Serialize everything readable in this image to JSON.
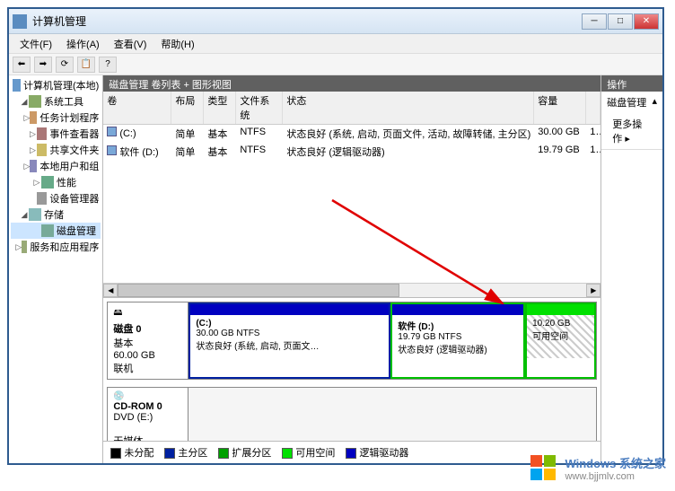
{
  "window": {
    "title": "计算机管理"
  },
  "menu": {
    "file": "文件(F)",
    "action": "操作(A)",
    "view": "查看(V)",
    "help": "帮助(H)"
  },
  "tree": {
    "root": "计算机管理(本地)",
    "system_tools": "系统工具",
    "task_scheduler": "任务计划程序",
    "event_viewer": "事件查看器",
    "shared_folders": "共享文件夹",
    "local_users": "本地用户和组",
    "performance": "性能",
    "device_manager": "设备管理器",
    "storage": "存储",
    "disk_management": "磁盘管理",
    "services": "服务和应用程序"
  },
  "center": {
    "header": "磁盘管理  卷列表 + 图形视图"
  },
  "vol_columns": {
    "volume": "卷",
    "layout": "布局",
    "type": "类型",
    "filesystem": "文件系统",
    "status": "状态",
    "capacity": "容量"
  },
  "volumes": [
    {
      "name": "(C:)",
      "layout": "简单",
      "type": "基本",
      "fs": "NTFS",
      "status": "状态良好 (系统, 启动, 页面文件, 活动, 故障转储, 主分区)",
      "capacity": "30.00 GB",
      "free": "1…"
    },
    {
      "name": "软件 (D:)",
      "layout": "简单",
      "type": "基本",
      "fs": "NTFS",
      "status": "状态良好 (逻辑驱动器)",
      "capacity": "19.79 GB",
      "free": "1…"
    }
  ],
  "disks": {
    "disk0": {
      "label": "磁盘 0",
      "type": "基本",
      "size": "60.00 GB",
      "state": "联机",
      "partitions": [
        {
          "title": "(C:)",
          "detail1": "30.00 GB NTFS",
          "detail2": "状态良好 (系统, 启动, 页面文…",
          "header_color": "#0000c0",
          "border_color": "#0020a0"
        },
        {
          "title": "软件  (D:)",
          "detail1": "19.79 GB NTFS",
          "detail2": "状态良好 (逻辑驱动器)",
          "header_color": "#0000c0",
          "border_color": "#00c000"
        },
        {
          "title": "",
          "detail1": "10.20 GB",
          "detail2": "可用空间",
          "header_color": "#00e000",
          "border_color": "#00c000",
          "hatched": true
        }
      ]
    },
    "cdrom": {
      "label": "CD-ROM 0",
      "type": "DVD (E:)",
      "state": "无媒体"
    }
  },
  "legend": {
    "unallocated": "未分配",
    "primary": "主分区",
    "extended": "扩展分区",
    "free": "可用空间",
    "logical": "逻辑驱动器"
  },
  "actions": {
    "header": "操作",
    "title": "磁盘管理",
    "more": "更多操作"
  },
  "watermark": {
    "line1": "Windows 系统之家",
    "line2": "www.bjjmlv.com"
  },
  "colors": {
    "primary": "#0020a0",
    "extended": "#00a000",
    "free": "#00e000",
    "logical": "#0000c0",
    "unallocated": "#000000"
  }
}
